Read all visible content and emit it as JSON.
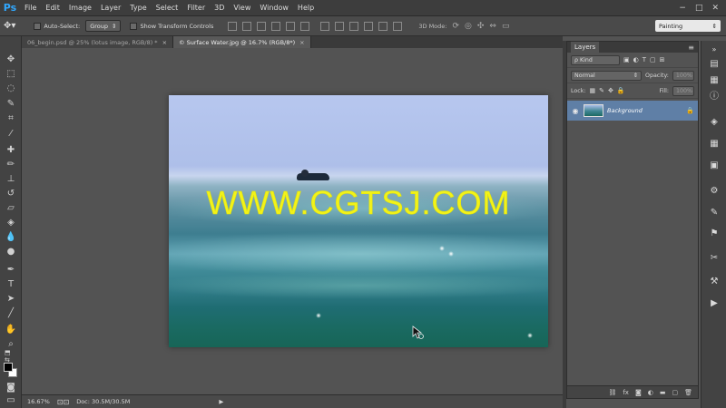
{
  "app": {
    "logo": "Ps"
  },
  "menu": [
    "File",
    "Edit",
    "Image",
    "Layer",
    "Type",
    "Select",
    "Filter",
    "3D",
    "View",
    "Window",
    "Help"
  ],
  "window_controls": [
    "−",
    "□",
    "✕"
  ],
  "options": {
    "auto_select_label": "Auto-Select:",
    "auto_select_value": "Group",
    "transform_label": "Show Transform Controls",
    "mode_3d_label": "3D Mode:",
    "workspace": "Painting"
  },
  "tabs": [
    {
      "label": "06_begin.psd @ 25% (lotus image, RGB/8) *",
      "close": "×"
    },
    {
      "label": "© Surface Water.jpg @ 16.7% (RGB/8*)",
      "close": "×"
    }
  ],
  "canvas": {
    "watermark": "WWW.CGTSJ.COM"
  },
  "status": {
    "zoom": "16.67%",
    "doc": "Doc: 30.5M/30.5M"
  },
  "layers": {
    "tab": "Layers",
    "kind_label": "ρ Kind",
    "blend_mode": "Normal",
    "opacity_label": "Opacity:",
    "opacity_value": "100%",
    "lock_label": "Lock:",
    "fill_label": "Fill:",
    "fill_value": "100%",
    "items": [
      {
        "name": "Background"
      }
    ]
  },
  "colors": {
    "accent_selection": "#5f7fa6",
    "ps_blue": "#31a8ff",
    "watermark": "#f2f21a"
  }
}
